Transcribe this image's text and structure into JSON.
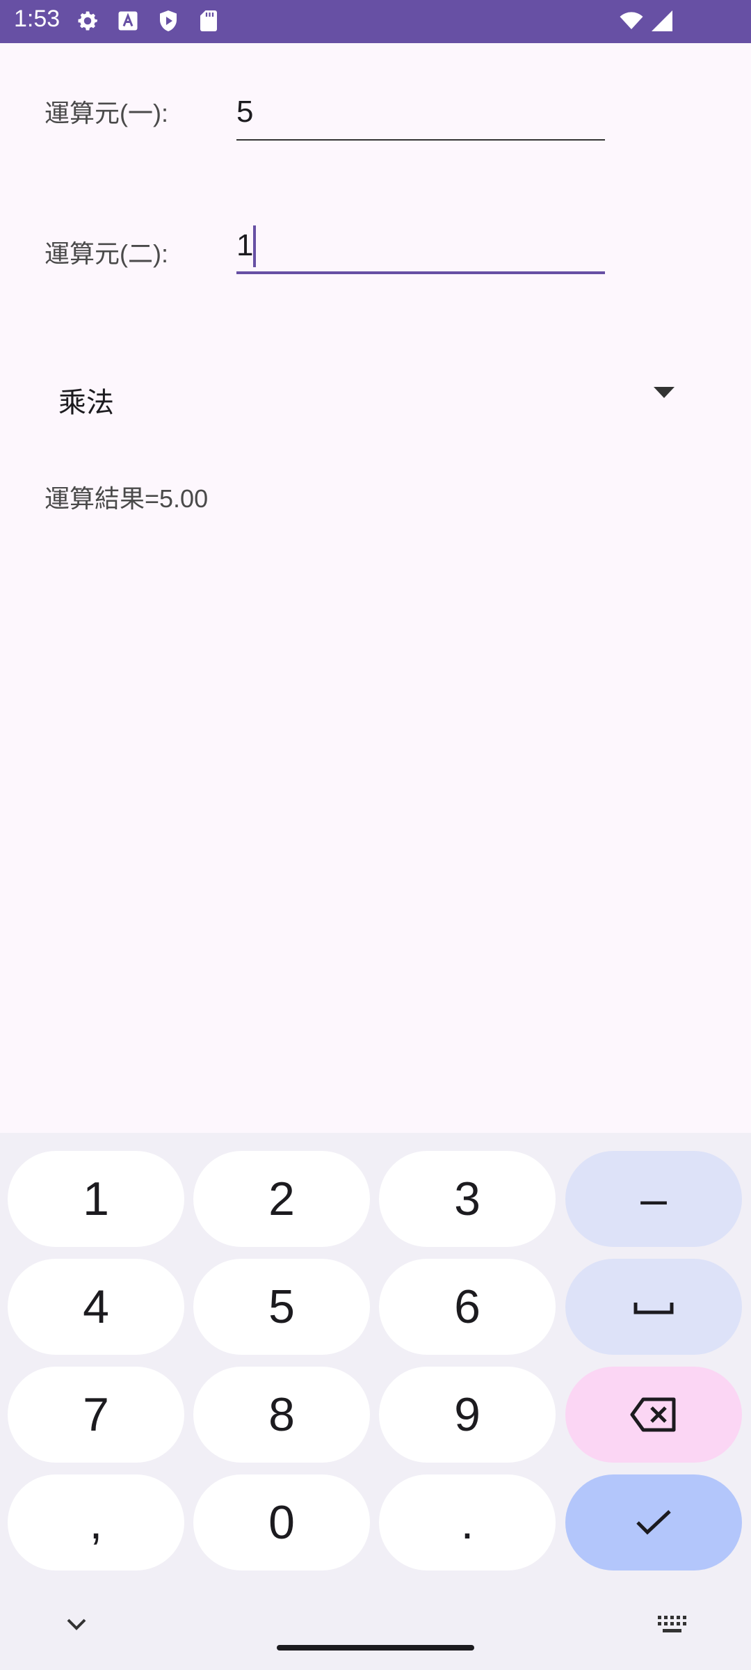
{
  "status_bar": {
    "time": "1:53",
    "icons": [
      "settings-icon",
      "accessibility-icon",
      "shield-play-icon",
      "sd-card-icon",
      "wifi-icon",
      "signal-icon"
    ]
  },
  "form": {
    "operand1_label": "運算元(一):",
    "operand1_value": "5",
    "operand2_label": "運算元(二):",
    "operand2_value": "1",
    "operator_selected": "乘法",
    "result_text": "運算結果=5.00"
  },
  "keyboard": {
    "keys": [
      "1",
      "2",
      "3",
      "–",
      "4",
      "5",
      "6",
      "space",
      "7",
      "8",
      "9",
      "backspace",
      ",",
      "0",
      ".",
      "done"
    ],
    "labels": {
      "k1": "1",
      "k2": "2",
      "k3": "3",
      "minus": "–",
      "k4": "4",
      "k5": "5",
      "k6": "6",
      "k7": "7",
      "k8": "8",
      "k9": "9",
      "comma": ",",
      "k0": "0",
      "dot": "."
    }
  },
  "colors": {
    "status_bar": "#6750a4",
    "background": "#fdf7fd",
    "keyboard_bg": "#f1eff6",
    "key_special": "#dde2f8",
    "key_backspace": "#fbd6f4",
    "key_done": "#b3c6fb"
  }
}
